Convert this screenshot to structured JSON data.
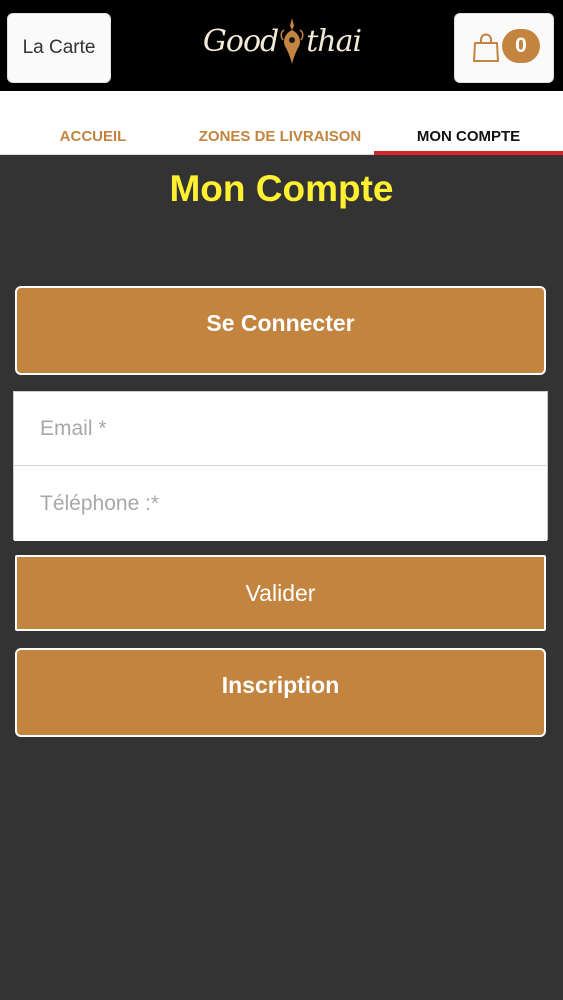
{
  "header": {
    "menu_label": "La Carte",
    "logo_left": "Good",
    "logo_right": "thai",
    "cart_count": "0",
    "cart_icon": "shopping-bag-icon"
  },
  "nav": {
    "tabs": [
      {
        "label": "ACCUEIL",
        "active": false
      },
      {
        "label": "ZONES DE LIVRAISON",
        "active": false
      },
      {
        "label": "MON COMPTE",
        "active": true
      }
    ]
  },
  "main": {
    "title": "Mon Compte",
    "connect_label": "Se Connecter",
    "email_placeholder": "Email *",
    "phone_placeholder": "Téléphone :*",
    "validate_label": "Valider",
    "register_label": "Inscription"
  },
  "colors": {
    "accent": "#c2843f",
    "title": "#fff032",
    "background": "#333333",
    "active_tab_underline": "#d6242a"
  }
}
